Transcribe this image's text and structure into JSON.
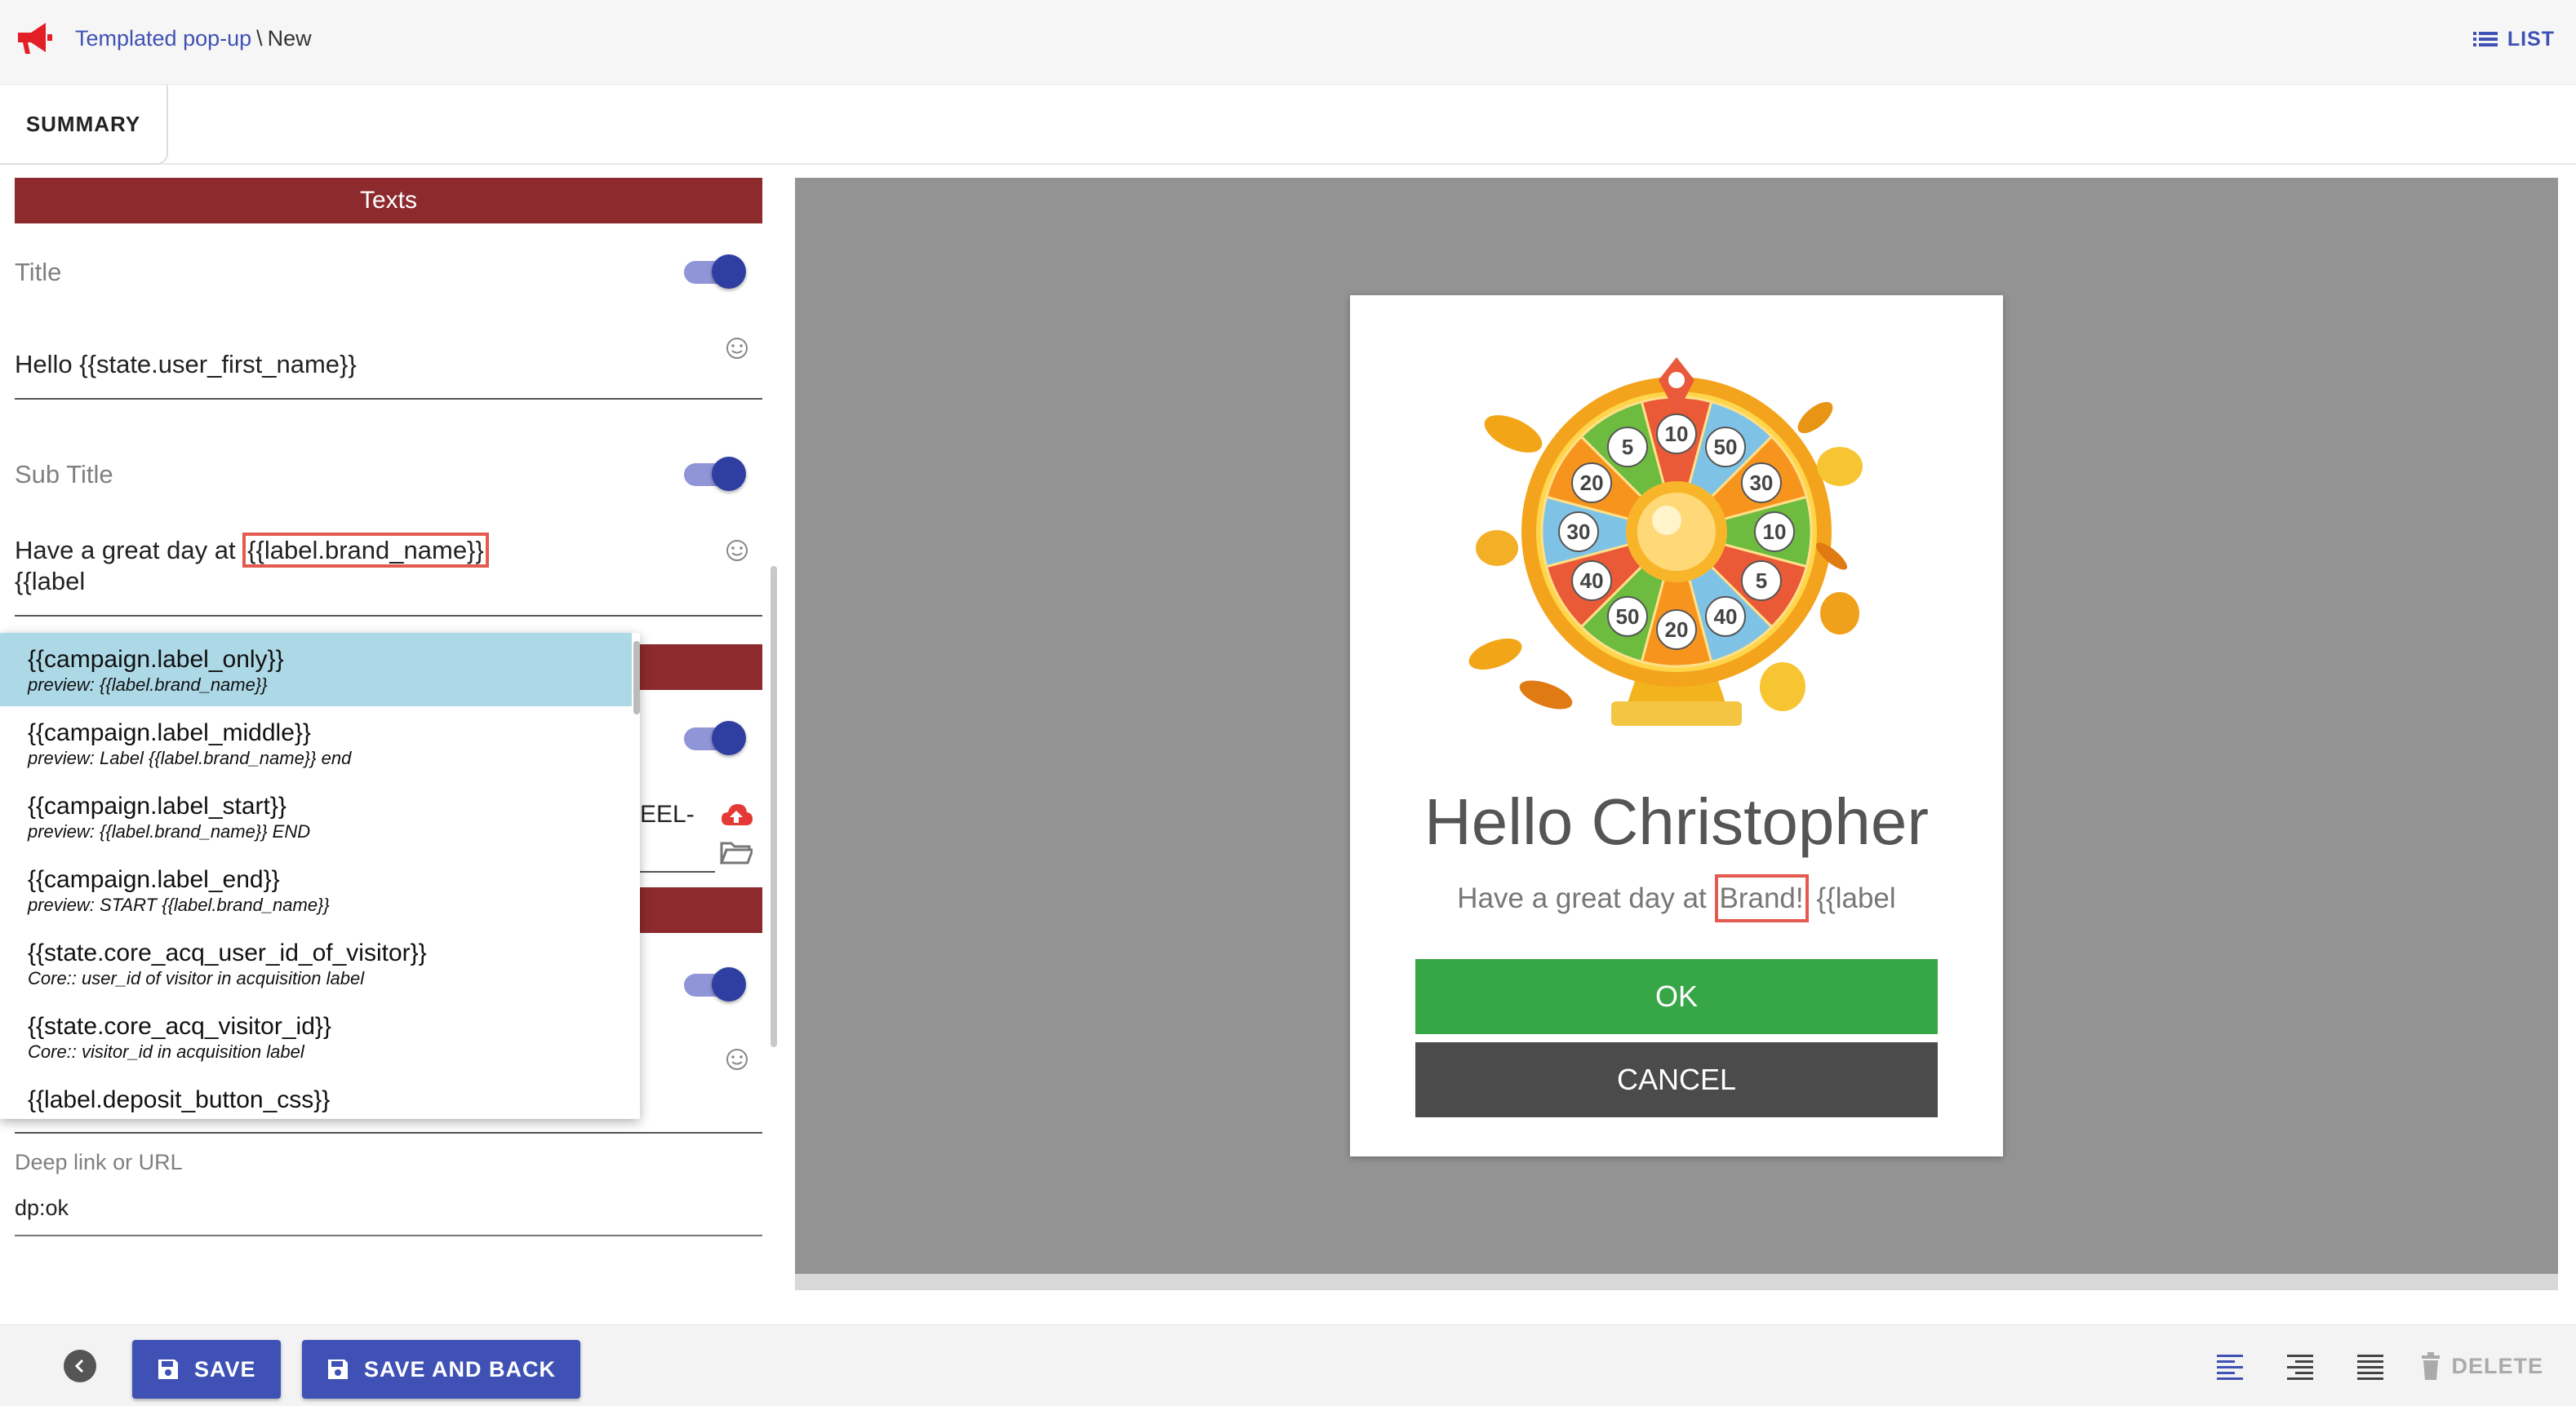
{
  "header": {
    "breadcrumb_link": "Templated pop-up",
    "breadcrumb_sep": "\\",
    "breadcrumb_current": "New",
    "list_label": "LIST",
    "logo_icon": "megaphone-icon"
  },
  "tabs": {
    "summary_label": "SUMMARY"
  },
  "texts_section": {
    "header": "Texts",
    "title_label": "Title",
    "title_value": "Hello {{state.user_first_name}}",
    "subtitle_label": "Sub Title",
    "subtitle_prefix": "Have a great day at ",
    "subtitle_tag": "{{label.brand_name}}",
    "subtitle_line2": "{{label",
    "partial_text": "EEL-"
  },
  "autocomplete": {
    "items": [
      {
        "name": "{{campaign.label_only}}",
        "desc": "preview: {{label.brand_name}}"
      },
      {
        "name": "{{campaign.label_middle}}",
        "desc": "preview: Label {{label.brand_name}} end"
      },
      {
        "name": "{{campaign.label_start}}",
        "desc": "preview: {{label.brand_name}} END"
      },
      {
        "name": "{{campaign.label_end}}",
        "desc": "preview: START {{label.brand_name}}"
      },
      {
        "name": "{{state.core_acq_user_id_of_visitor}}",
        "desc": "Core:: user_id of visitor in acquisition label"
      },
      {
        "name": "{{state.core_acq_visitor_id}}",
        "desc": "Core:: visitor_id in acquisition label"
      },
      {
        "name": "{{label.deposit_button_css}}",
        "desc": ""
      }
    ]
  },
  "deep_link": {
    "label": "Deep link or URL",
    "value": "dp:ok"
  },
  "preview": {
    "title": "Hello Christopher",
    "subtitle_prefix": "Have a great day at ",
    "subtitle_brand": "Brand!",
    "subtitle_suffix": " {{label",
    "ok_label": "OK",
    "cancel_label": "CANCEL",
    "image": "prize-wheel-illustration",
    "wheel_numbers": [
      "10",
      "50",
      "30",
      "10",
      "5",
      "40",
      "20",
      "50",
      "40",
      "30",
      "20",
      "5"
    ]
  },
  "footer": {
    "save_label": "SAVE",
    "save_back_label": "SAVE AND BACK",
    "delete_label": "DELETE"
  },
  "colors": {
    "accent": "#3f51b5",
    "section_bar": "#8c2a2e",
    "ok_button": "#37a647",
    "cancel_button": "#4b4b4b",
    "highlight": "#e55a4e",
    "active_item": "#add8e6"
  }
}
